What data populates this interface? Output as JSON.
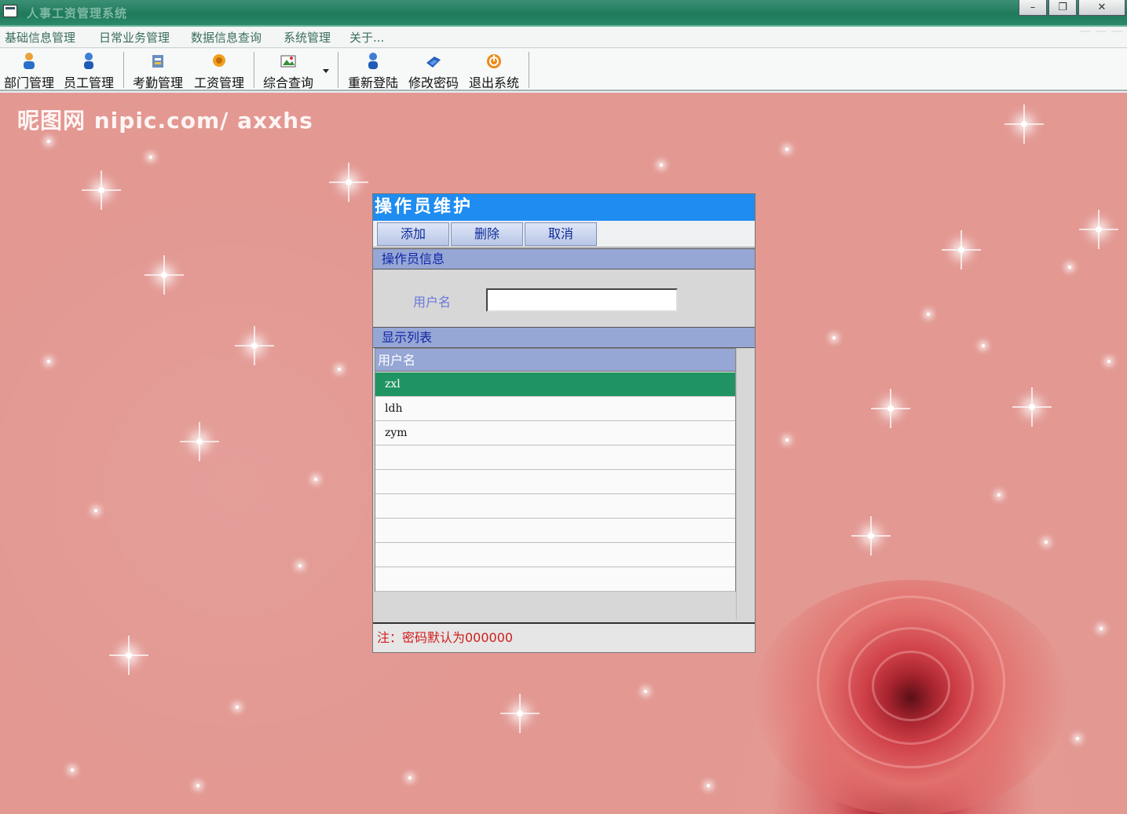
{
  "window": {
    "title": "人事工资管理系统",
    "minimize_label": "–",
    "restore_label": "❐",
    "close_label": "✕"
  },
  "menu": {
    "items": [
      {
        "label": "基础信息管理"
      },
      {
        "label": "日常业务管理"
      },
      {
        "label": "数据信息查询"
      },
      {
        "label": "系统管理"
      },
      {
        "label": "关于..."
      }
    ]
  },
  "toolbar": {
    "buttons": [
      {
        "label": "部门管理",
        "icon": "users-icon"
      },
      {
        "label": "员工管理",
        "icon": "user-icon"
      },
      {
        "label": "考勤管理",
        "icon": "attendance-icon"
      },
      {
        "label": "工资管理",
        "icon": "coins-icon"
      },
      {
        "label": "综合查询",
        "icon": "picture-icon"
      },
      {
        "label": "重新登陆",
        "icon": "relogin-icon"
      },
      {
        "label": "修改密码",
        "icon": "key-icon"
      },
      {
        "label": "退出系统",
        "icon": "power-icon"
      }
    ]
  },
  "background": {
    "watermark": "昵图网 nipic.com/ axxhs"
  },
  "dialog": {
    "title": "操作员维护",
    "buttons": {
      "add": "添加",
      "delete": "删除",
      "cancel": "取消"
    },
    "info_section": "操作员信息",
    "username_label": "用户名",
    "username_value": "",
    "list_section": "显示列表",
    "list_header": "用户名",
    "rows": [
      "zxl",
      "ldh",
      "zym",
      "",
      "",
      "",
      "",
      "",
      ""
    ],
    "selected_row": 0,
    "footer_note": "注：密码默认为000000"
  },
  "colors": {
    "dialog_title_bg": "#1e8cf0",
    "section_header_bg": "#96a6d5",
    "selected_row_bg": "#1f9462",
    "note_text": "#d21c1c",
    "background": "#e39892"
  }
}
